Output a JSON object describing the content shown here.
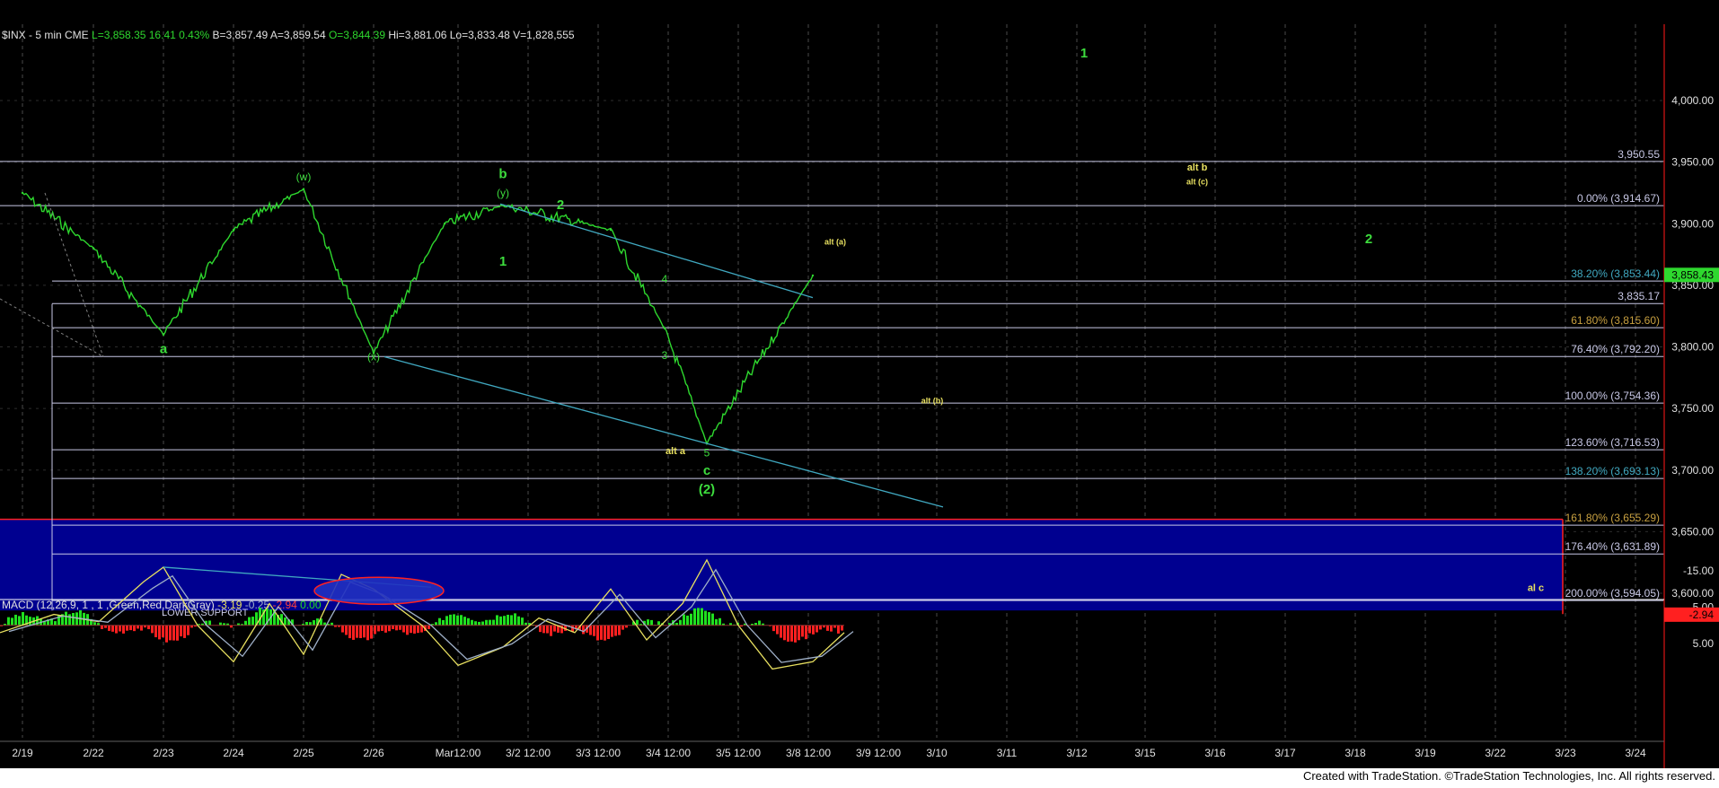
{
  "colors": {
    "background": "#000000",
    "price": "#2ed82e",
    "fib_line": "#c8c8e6",
    "trend_line": "#40a8c0",
    "wave_green": "#3ddc3d",
    "wave_yellow": "#e8e060",
    "support_zone": "#000090",
    "macd": "#e8e060",
    "signal": "#9fb0c8",
    "hist_pos": "#20e020",
    "hist_neg": "#ff2020",
    "ellipse": "#2030c0",
    "ellipse_border": "#ff2020"
  },
  "header": {
    "symbol": "$INX - 5 min  CME",
    "last": "L=3,858.35",
    "change": "16.41",
    "change_pct": "0.43%",
    "bid": "B=3,857.49",
    "ask": "A=3,859.54",
    "open": "O=3,844.39",
    "high": "Hi=3,881.06",
    "low": "Lo=3,833.48",
    "volume": "V=1,828,555"
  },
  "footer": {
    "credit": "Created with TradeStation. ©TradeStation Technologies, Inc. All rights reserved."
  },
  "chart_data": [
    {
      "type": "line",
      "series": [
        {
          "name": "$INX - 5 min",
          "x": [
            "2/19",
            "2/22",
            "2/23",
            "2/24",
            "2/25",
            "2/26",
            "Mar",
            "3/2",
            "3/3",
            "3/4",
            "3/5",
            "3/8"
          ],
          "values": [
            3925,
            3880,
            3810,
            3895,
            3928,
            3795,
            3900,
            3915,
            3895,
            3815,
            3722,
            3858
          ]
        }
      ],
      "ylim": [
        3590,
        4050
      ],
      "y_ticks": [
        "4,000.00",
        "3,950.00",
        "3,900.00",
        "3,850.00",
        "3,800.00",
        "3,750.00",
        "3,700.00",
        "3,650.00",
        "3,600.00"
      ],
      "x_ticks": [
        "2/19",
        "2/22",
        "2/23",
        "2/24",
        "2/25",
        "2/26",
        "Mar12:00",
        "3/2 12:00",
        "3/3 12:00",
        "3/4 12:00",
        "3/5 12:00",
        "3/8 12:00",
        "3/9 12:00",
        "3/10",
        "3/11",
        "3/12",
        "3/15",
        "3/16",
        "3/17",
        "3/18",
        "3/19",
        "3/22",
        "3/23",
        "3/24"
      ],
      "last_price": "3,858.43",
      "levels": [
        {
          "label": "3,950.55",
          "value": 3950.55
        },
        {
          "label": "0.00% (3,914.67)",
          "value": 3914.67
        },
        {
          "label": "38.20% (3,853.44)",
          "value": 3853.44
        },
        {
          "label": "3,835.17",
          "value": 3835.17
        },
        {
          "label": "61.80% (3,815.60)",
          "value": 3815.6
        },
        {
          "label": "76.40% (3,792.20)",
          "value": 3792.2
        },
        {
          "label": "100.00% (3,754.36)",
          "value": 3754.36
        },
        {
          "label": "123.60% (3,716.53)",
          "value": 3716.53
        },
        {
          "label": "138.20% (3,693.13)",
          "value": 3693.13
        },
        {
          "label": "161.80% (3,655.29)",
          "value": 3655.29
        },
        {
          "label": "176.40% (3,631.89)",
          "value": 3631.89
        },
        {
          "label": "200.00% (3,594.05)",
          "value": 3594.05
        }
      ],
      "zone_label": "LOWER SUPPORT",
      "annotations": [
        {
          "text": "(w)",
          "x": "2/25",
          "value": 3935,
          "color": "green"
        },
        {
          "text": "b",
          "x": "3/2",
          "value": 3937,
          "color": "green"
        },
        {
          "text": "(y)",
          "x": "3/2",
          "value": 3922,
          "color": "green"
        },
        {
          "text": "2",
          "x": "3/2 12:00",
          "value": 3912,
          "color": "green"
        },
        {
          "text": "1",
          "x": "3/2",
          "value": 3866,
          "color": "green"
        },
        {
          "text": "4",
          "x": "3/4",
          "value": 3852,
          "color": "green"
        },
        {
          "text": "3",
          "x": "3/4",
          "value": 3790,
          "color": "green"
        },
        {
          "text": "5",
          "x": "3/5",
          "value": 3711,
          "color": "green"
        },
        {
          "text": "c",
          "x": "3/5",
          "value": 3696,
          "color": "green"
        },
        {
          "text": "(2)",
          "x": "3/5",
          "value": 3681,
          "color": "green"
        },
        {
          "text": "a",
          "x": "2/23",
          "value": 3795,
          "color": "green"
        },
        {
          "text": "(x)",
          "x": "2/26",
          "value": 3789,
          "color": "green"
        },
        {
          "text": "alt a",
          "x": "3/4 12:00",
          "value": 3713,
          "color": "yellow"
        },
        {
          "text": "alt (a)",
          "x": "3/8 12:00",
          "value": 3883,
          "color": "yellow"
        },
        {
          "text": "alt (b)",
          "x": "3/10",
          "value": 3754,
          "color": "yellow"
        },
        {
          "text": "alt b",
          "x": "3/15",
          "value": 3943,
          "color": "yellow"
        },
        {
          "text": "alt (c)",
          "x": "3/15",
          "value": 3932,
          "color": "yellow"
        },
        {
          "text": "1",
          "x": "3/12",
          "value": 4035,
          "color": "green"
        },
        {
          "text": "2",
          "x": "3/18",
          "value": 3884,
          "color": "green"
        },
        {
          "text": "al c",
          "x": "3/23",
          "value": 3602,
          "color": "yellow"
        }
      ]
    },
    {
      "type": "line",
      "title": "MACD (12,26,9, 1 , 1 ,Green,Red,DarkGray)",
      "readouts": [
        "-3.19",
        "-0.25",
        "-2.94",
        "0.00"
      ],
      "y_ticks": [
        "5.00",
        "-5.00",
        "-15.00"
      ],
      "last_value": "-2.94",
      "ylim": [
        -20,
        12
      ]
    }
  ]
}
